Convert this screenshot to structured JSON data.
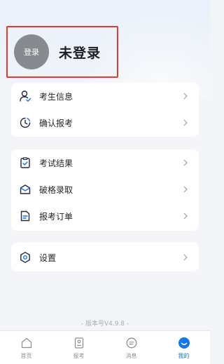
{
  "profile": {
    "avatar_text": "登录",
    "title": "未登录"
  },
  "menu": {
    "group1": [
      {
        "label": "考生信息",
        "icon": "person-icon"
      },
      {
        "label": "确认报考",
        "icon": "clock-icon"
      }
    ],
    "group2": [
      {
        "label": "考试结果",
        "icon": "clipboard-check-icon"
      },
      {
        "label": "破格录取",
        "icon": "envelope-icon"
      },
      {
        "label": "报考订单",
        "icon": "document-icon"
      }
    ],
    "group3": [
      {
        "label": "设置",
        "icon": "settings-icon"
      }
    ]
  },
  "version": "- 版本号V4.9.8 -",
  "tabbar": {
    "items": [
      {
        "label": "首页",
        "icon": "home-icon"
      },
      {
        "label": "报考",
        "icon": "exam-icon"
      },
      {
        "label": "消息",
        "icon": "message-icon"
      },
      {
        "label": "我的",
        "icon": "profile-icon"
      }
    ],
    "active_index": 3
  },
  "colors": {
    "accent": "#1677e6",
    "highlight_border": "#e53935",
    "avatar_bg": "#878a8f"
  }
}
